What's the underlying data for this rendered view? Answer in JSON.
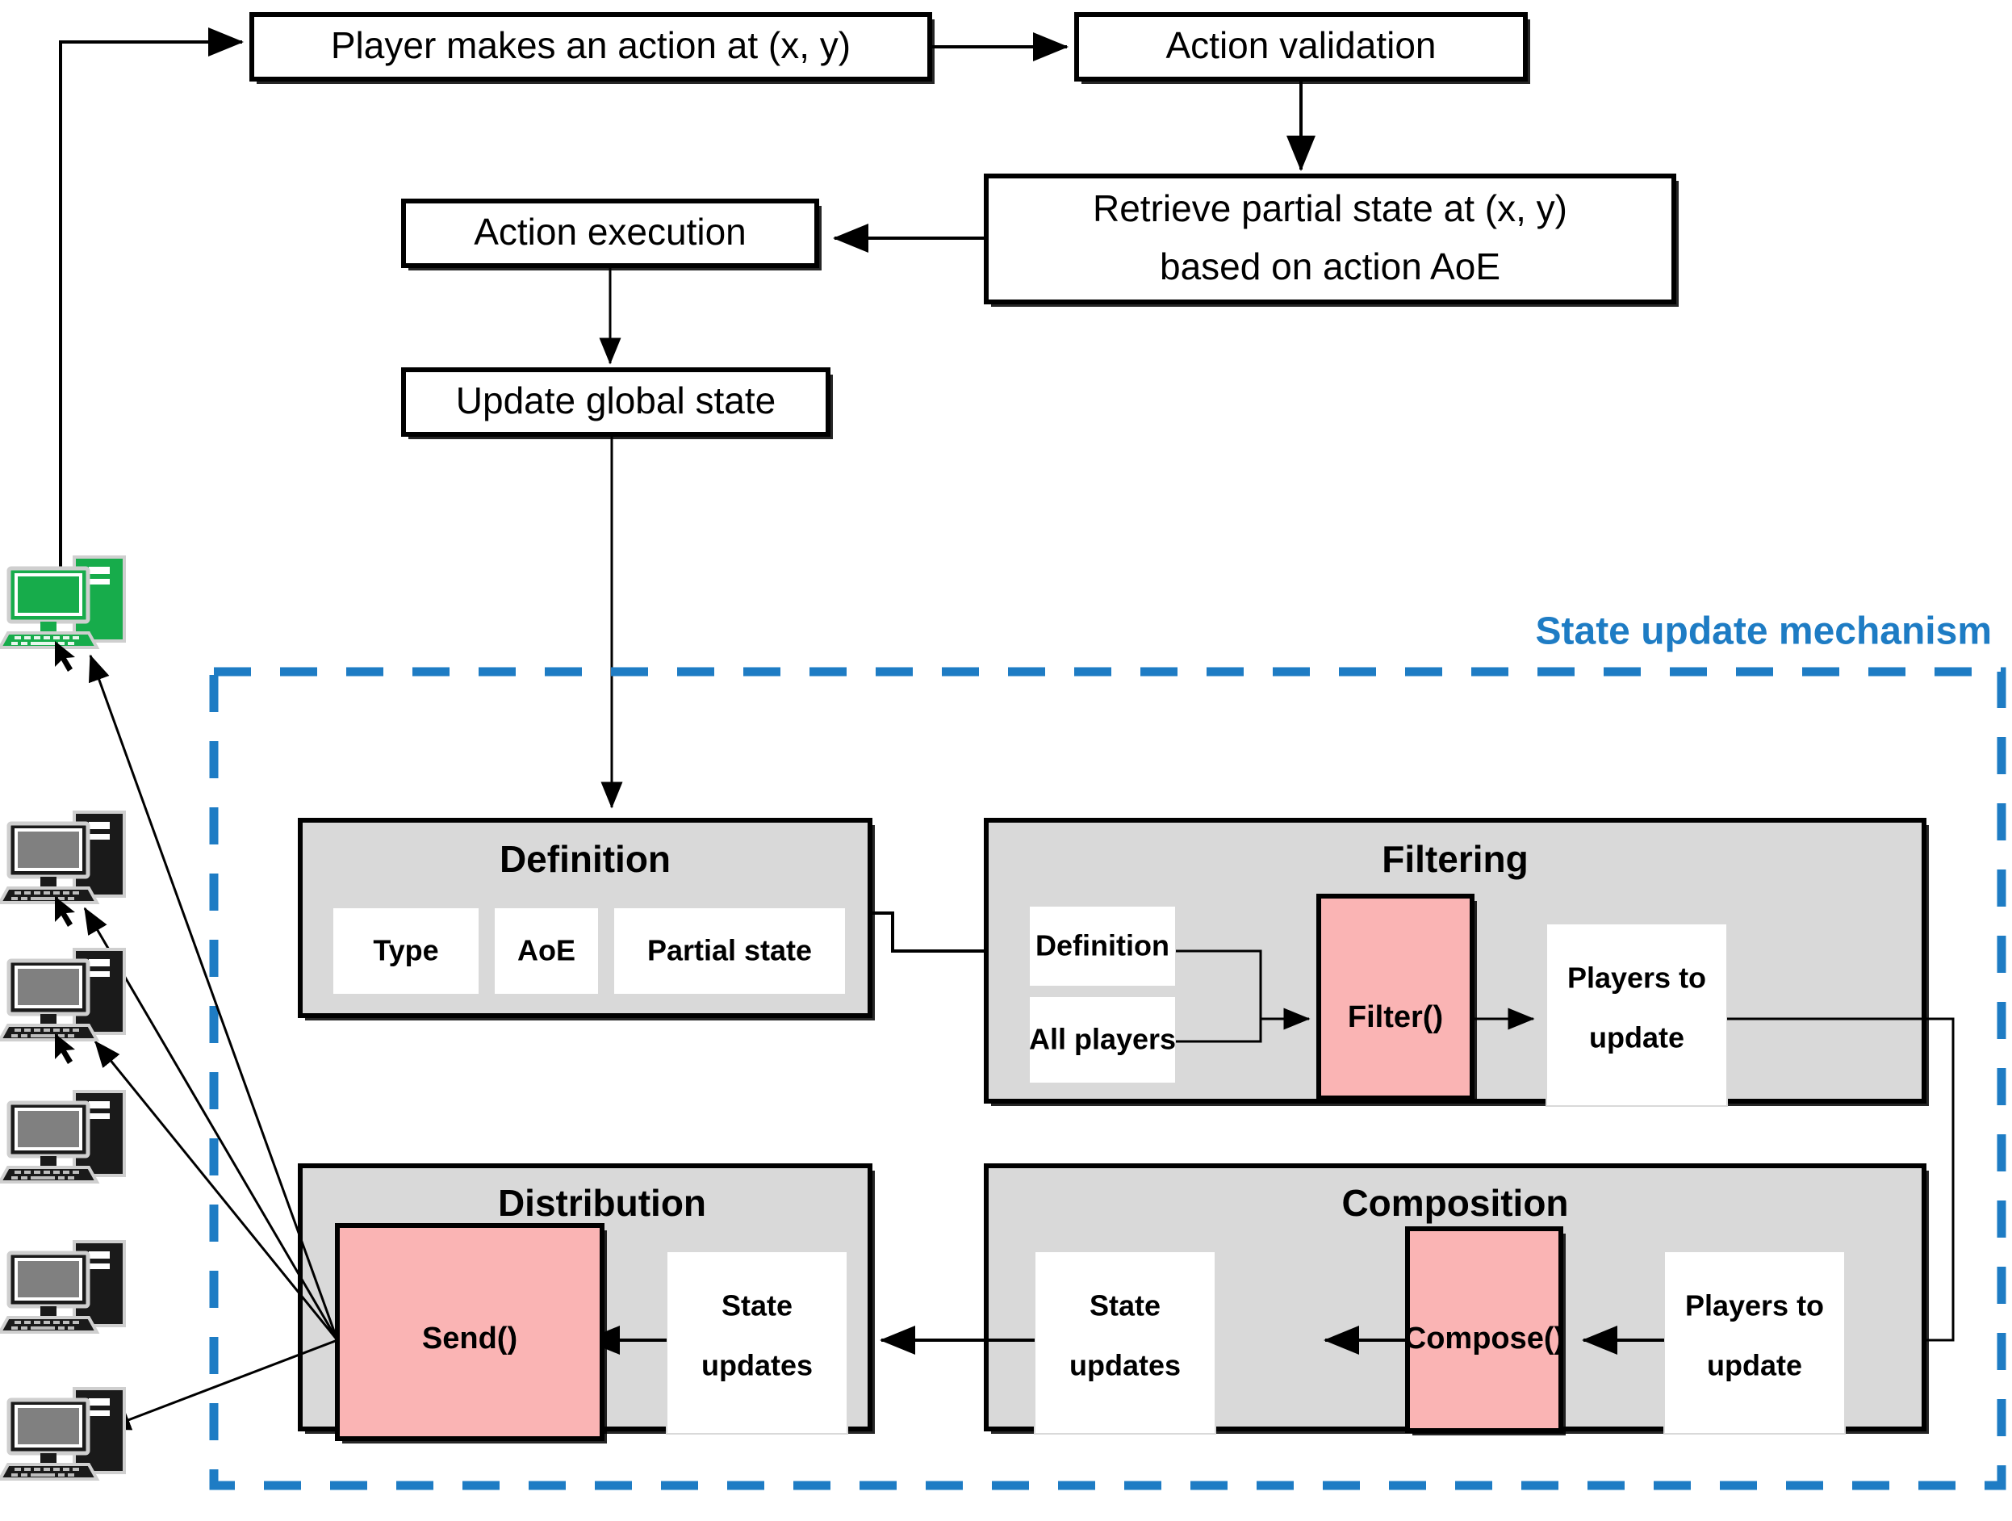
{
  "colors": {
    "accent_blue": "#1E7CC4",
    "group_gray": "#D9D9D9",
    "function_pink": "#FAB4B4",
    "active_client_green": "#17AC4B",
    "client_gray": "#808080",
    "client_dark": "#1A1A1A",
    "line_black": "#000000",
    "box_white": "#FFFFFF"
  },
  "flow": {
    "player_action": "Player makes an action at (x, y)",
    "action_validation": "Action validation",
    "retrieve_partial_state_line1": "Retrieve partial state at (x, y)",
    "retrieve_partial_state_line2": "based on action AoE",
    "action_execution": "Action execution",
    "update_global_state": "Update global state"
  },
  "mechanism": {
    "label": "State update mechanism"
  },
  "groups": {
    "definition": {
      "title": "Definition",
      "chips": [
        "Type",
        "AoE",
        "Partial state"
      ]
    },
    "filtering": {
      "title": "Filtering",
      "inputs": [
        "Definition",
        "All players"
      ],
      "function": "Filter()",
      "output_line1": "Players to",
      "output_line2": "update"
    },
    "composition": {
      "title": "Composition",
      "input_line1": "Players to",
      "input_line2": "update",
      "function": "Compose()",
      "output_line1": "State",
      "output_line2": "updates"
    },
    "distribution": {
      "title": "Distribution",
      "input_line1": "State",
      "input_line2": "updates",
      "function": "Send()"
    }
  },
  "clients": [
    {
      "name": "client-active",
      "state": "active",
      "color": "#17AC4B"
    },
    {
      "name": "client-1",
      "state": "idle",
      "color": "#808080"
    },
    {
      "name": "client-2",
      "state": "idle",
      "color": "#808080"
    },
    {
      "name": "client-3",
      "state": "idle",
      "color": "#808080"
    },
    {
      "name": "client-4",
      "state": "idle",
      "color": "#808080"
    },
    {
      "name": "client-5",
      "state": "idle",
      "color": "#808080"
    }
  ]
}
